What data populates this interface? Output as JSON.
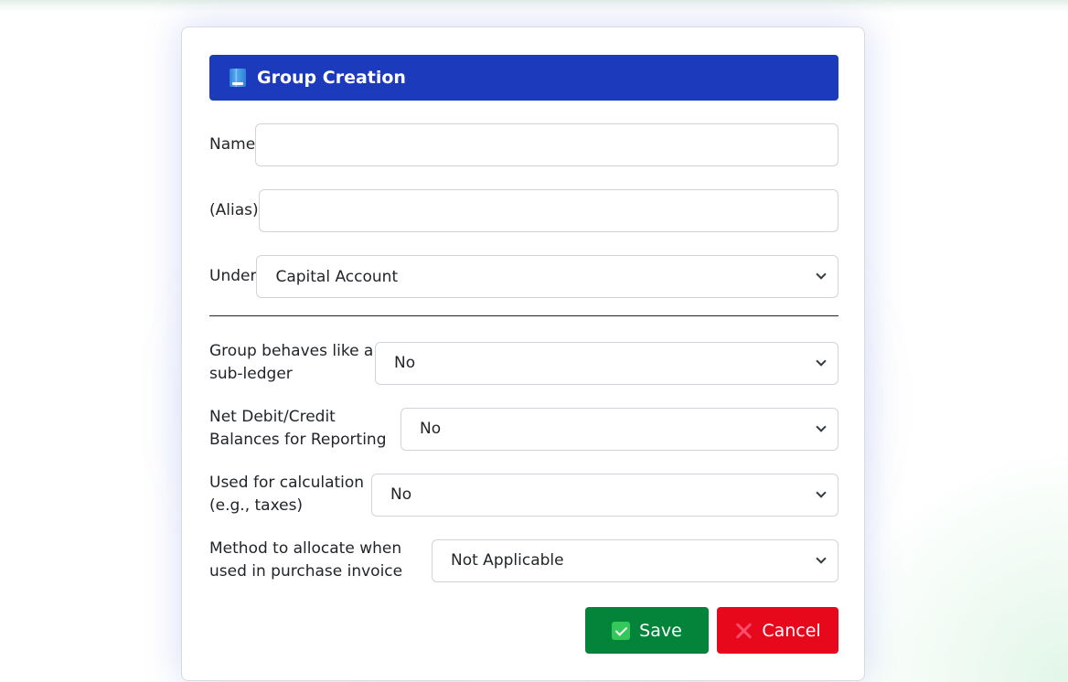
{
  "form": {
    "title": "Group Creation",
    "title_icon": "book-icon",
    "name_label": "Name",
    "name_value": "",
    "alias_label": "(Alias)",
    "alias_value": "",
    "under_label": "Under",
    "under_value": "Capital Account",
    "subledger_label": "Group behaves like a sub-ledger",
    "subledger_value": "No",
    "net_balances_label": "Net Debit/Credit Balances for Reporting",
    "net_balances_value": "No",
    "calculation_label": "Used for calculation (e.g., taxes)",
    "calculation_value": "No",
    "allocate_label": "Method to allocate when used in purchase invoice",
    "allocate_value": "Not Applicable"
  },
  "actions": {
    "save_label": "Save",
    "save_icon": "check-icon",
    "cancel_label": "Cancel",
    "cancel_icon": "x-icon"
  },
  "colors": {
    "header_bg": "#1c3bbc",
    "save_bg": "#04843a",
    "cancel_bg": "#e8081c"
  }
}
